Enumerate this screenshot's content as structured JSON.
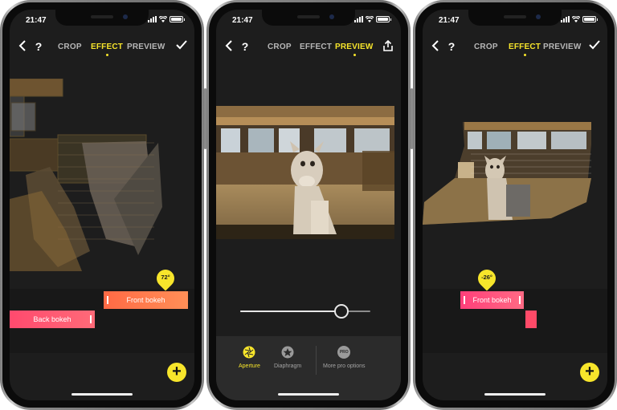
{
  "status": {
    "time": "21:47"
  },
  "phones": [
    {
      "tabs": [
        "CROP",
        "EFFECT",
        "PREVIEW"
      ],
      "active_tab": "EFFECT",
      "help": "?",
      "bars": {
        "front": "Front bokeh",
        "back": "Back bokeh"
      },
      "marker": "72°",
      "add_label": "+"
    },
    {
      "tabs": [
        "CROP",
        "EFFECT",
        "PREVIEW"
      ],
      "active_tab": "PREVIEW",
      "help": "?",
      "slider": {
        "value": 0.81
      },
      "options": [
        {
          "label": "Aperture",
          "icon": "aperture-icon"
        },
        {
          "label": "Diaphragm",
          "icon": "diaphragm-icon"
        },
        {
          "label": "More pro options",
          "icon": "pro-icon",
          "badge": "PRO"
        }
      ]
    },
    {
      "tabs": [
        "CROP",
        "EFFECT",
        "PREVIEW"
      ],
      "active_tab": "EFFECT",
      "help": "?",
      "bars": {
        "front": "Front bokeh"
      },
      "marker": "-26°",
      "add_label": "+"
    }
  ],
  "colors": {
    "accent": "#f7e52b",
    "bar_orange": "#ff7a4a",
    "bar_pink": "#ff3f7a"
  }
}
